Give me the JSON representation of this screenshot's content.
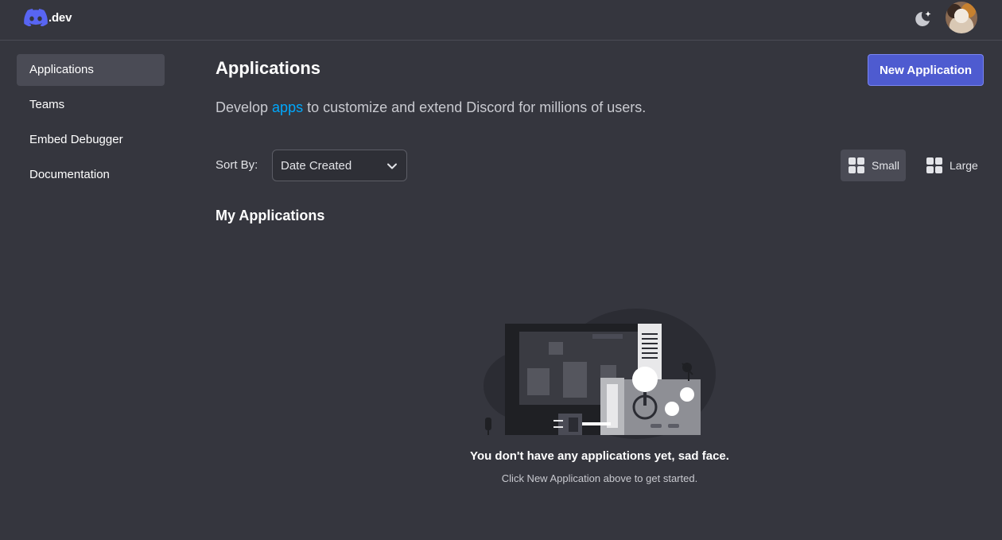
{
  "header": {
    "logo_text": ".dev",
    "brand_color": "#5865f2",
    "icons": [
      "discord-logo-icon",
      "moon-sparkle-icon",
      "avatar"
    ]
  },
  "sidebar": {
    "items": [
      {
        "label": "Applications",
        "active": true
      },
      {
        "label": "Teams",
        "active": false
      },
      {
        "label": "Embed Debugger",
        "active": false
      },
      {
        "label": "Documentation",
        "active": false
      }
    ]
  },
  "main": {
    "title": "Applications",
    "new_button": "New Application",
    "subtitle_pre": "Develop ",
    "subtitle_link": "apps",
    "subtitle_post": " to customize and extend Discord for millions of users.",
    "sort_label": "Sort By:",
    "sort_value": "Date Created",
    "view_small": "Small",
    "view_large": "Large",
    "section_title": "My Applications",
    "empty_title": "You don't have any applications yet, sad face.",
    "empty_subtitle": "Click New Application above to get started."
  },
  "colors": {
    "background": "#35363e",
    "accent_button": "#4e5bd0",
    "link": "#00a8fc"
  }
}
